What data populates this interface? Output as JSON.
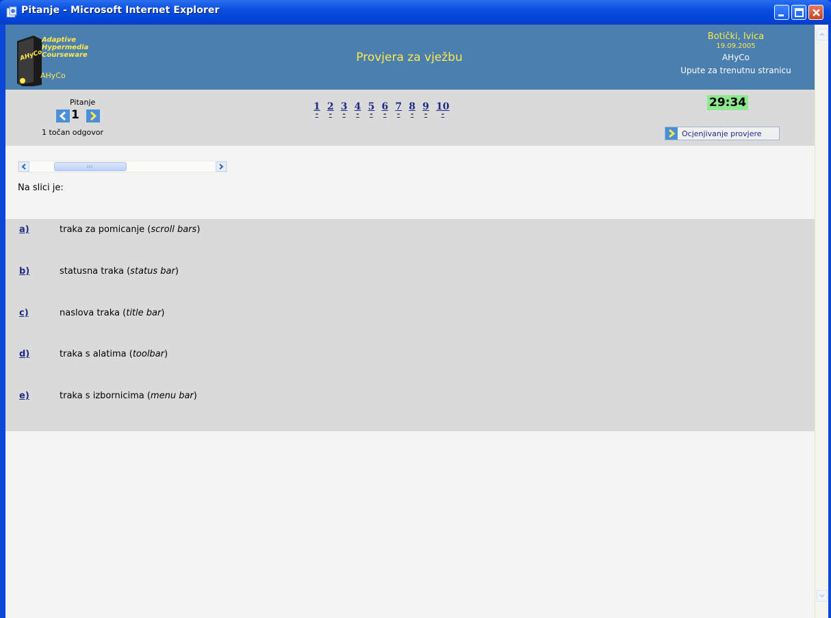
{
  "window": {
    "title": "Pitanje - Microsoft Internet Explorer"
  },
  "header": {
    "logo_lines": [
      "Adaptive",
      "Hypermedia",
      "Courseware"
    ],
    "logo_sub": "AHyCo",
    "page_title": "Provjera za vježbu",
    "user_name": "Botički, Ivica",
    "date": "19.09.2005",
    "course": "AHyCo",
    "help_link": "Upute za trenutnu stranicu"
  },
  "nav": {
    "question_label": "Pitanje",
    "current_question": "1",
    "hint": "1 točan odgovor",
    "question_links": [
      "1",
      "2",
      "3",
      "4",
      "5",
      "6",
      "7",
      "8",
      "9",
      "10"
    ],
    "question_marks": [
      "-",
      "-",
      "-",
      "-",
      "-",
      "-",
      "-",
      "-",
      "-",
      "-"
    ],
    "timer": "29:34",
    "grade_button": "Ocjenjivanje provjere"
  },
  "question": {
    "text": "Na slici  je:"
  },
  "answers": [
    {
      "key": "a)",
      "text": "traka za pomicanje (",
      "term": "scroll bars",
      "end": ")"
    },
    {
      "key": "b)",
      "text": "statusna traka (",
      "term": "status bar",
      "end": ")"
    },
    {
      "key": "c)",
      "text": "naslova traka (",
      "term": "title bar",
      "end": ")"
    },
    {
      "key": "d)",
      "text": "traka s alatima (",
      "term": "toolbar",
      "end": ")"
    },
    {
      "key": "e)",
      "text": "traka s izbornicima (",
      "term": "menu bar",
      "end": ")"
    }
  ],
  "colors": {
    "header_bg": "#4a7fb0",
    "accent_yellow": "#ffe94a",
    "band_gray": "#dadada",
    "link_blue": "#1d2b87",
    "timer_green": "#8fe88f"
  }
}
